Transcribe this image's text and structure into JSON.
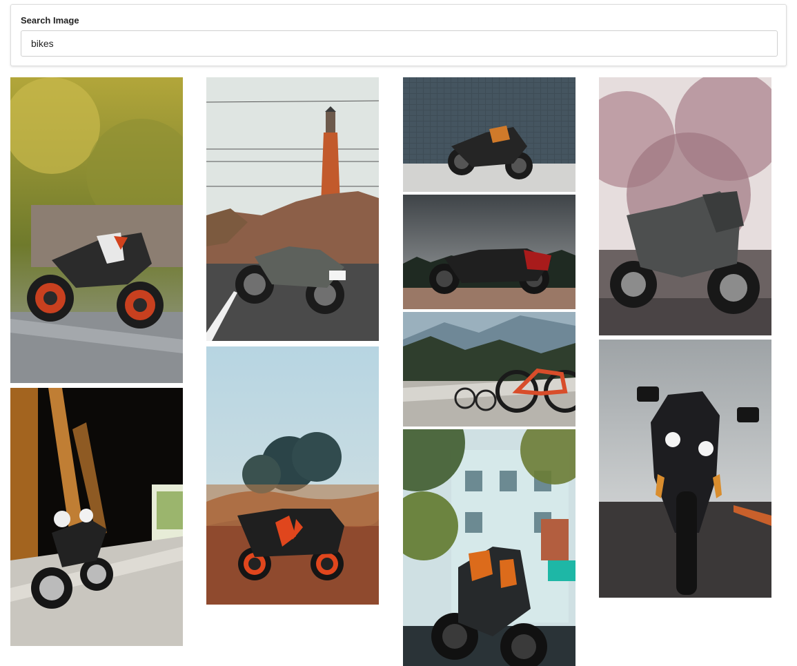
{
  "search": {
    "label": "Search Image",
    "value": "bikes"
  },
  "gallery": {
    "images": [
      {
        "name": "ktm-duke-bike-in-forest-photo",
        "icon": "motorcycle-photo",
        "dominant_colors": [
          "#a9a33a",
          "#53652a",
          "#bb3a22",
          "#858a8f"
        ]
      },
      {
        "name": "classic-bike-by-lighthouse-photo",
        "icon": "motorcycle-photo",
        "dominant_colors": [
          "#d9e1df",
          "#c05a2e",
          "#8a6451",
          "#4a4a4a"
        ]
      },
      {
        "name": "electric-bike-by-tile-wall-photo",
        "icon": "motorcycle-photo",
        "dominant_colors": [
          "#3f4e58",
          "#cfcfcf",
          "#d07a2a",
          "#202020"
        ]
      },
      {
        "name": "cruiser-bike-cloudy-sky-photo",
        "icon": "motorcycle-photo",
        "dominant_colors": [
          "#5c6165",
          "#262626",
          "#9a7665",
          "#b11c1c"
        ]
      },
      {
        "name": "bicycles-mountain-road-photo",
        "icon": "bicycle-photo",
        "dominant_colors": [
          "#3c4d3c",
          "#b7b4ad",
          "#d84d2a",
          "#6f8897"
        ]
      },
      {
        "name": "pulsar-bike-with-pink-trees-photo",
        "icon": "motorcycle-photo",
        "dominant_colors": [
          "#b8919b",
          "#4d4d4d",
          "#7b6a6e",
          "#e3d8d8"
        ]
      },
      {
        "name": "scrambler-bike-under-covered-bridge-photo",
        "icon": "motorcycle-photo",
        "dominant_colors": [
          "#0a0806",
          "#b7722d",
          "#d5d2cc",
          "#3c2a19"
        ]
      },
      {
        "name": "sport-bike-in-dry-grass-photo",
        "icon": "motorcycle-photo",
        "dominant_colors": [
          "#bad5e0",
          "#a0522d",
          "#1d1d1d",
          "#e0471c"
        ]
      },
      {
        "name": "ktm-bike-by-buildings-photo",
        "icon": "motorcycle-photo",
        "dominant_colors": [
          "#4e6a3a",
          "#c9e1e6",
          "#dc6b1b",
          "#222a2d"
        ]
      },
      {
        "name": "superbike-front-view-photo",
        "icon": "motorcycle-photo",
        "dominant_colors": [
          "#c2c6c8",
          "#1b1b1b",
          "#d98d2e",
          "#46464a"
        ]
      }
    ]
  }
}
